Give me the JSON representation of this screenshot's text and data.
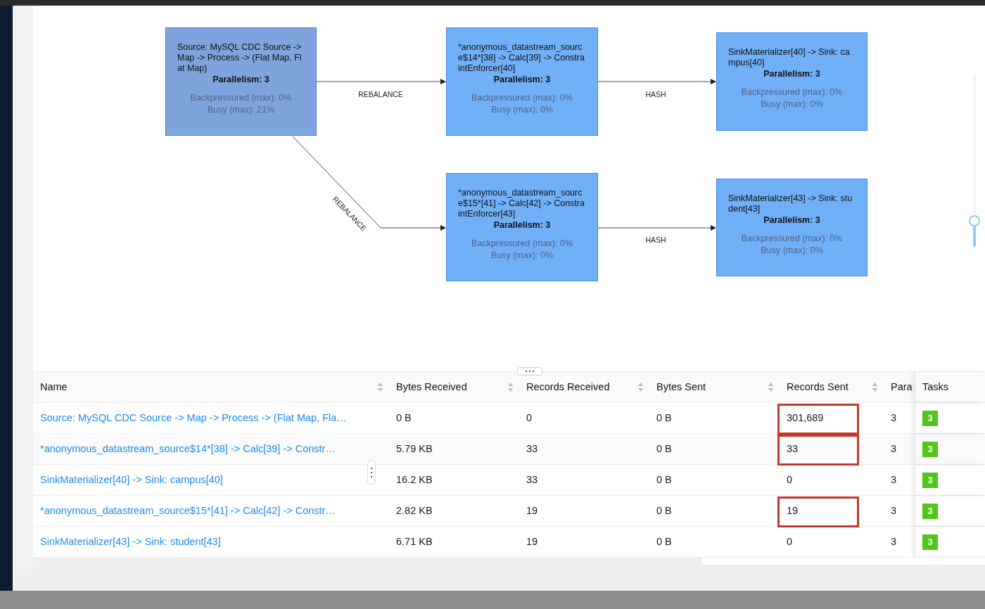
{
  "graph": {
    "nodes": [
      {
        "title": "Source: MySQL CDC Source -> Map -> Process -> (Flat Map, Flat Map)",
        "parallelism": "Parallelism: 3",
        "backpressured": "Backpressured (max): 0%",
        "busy": "Busy (max): 21%",
        "selected": true
      },
      {
        "title": "*anonymous_datastream_source$14*[38] -> Calc[39] -> ConstraintEnforcer[40]",
        "parallelism": "Parallelism: 3",
        "backpressured": "Backpressured (max): 0%",
        "busy": "Busy (max): 0%",
        "selected": false
      },
      {
        "title": "SinkMaterializer[40] -> Sink: campus[40]",
        "parallelism": "Parallelism: 3",
        "backpressured": "Backpressured (max): 0%",
        "busy": "Busy (max): 0%",
        "selected": false
      },
      {
        "title": "*anonymous_datastream_source$15*[41] -> Calc[42] -> ConstraintEnforcer[43]",
        "parallelism": "Parallelism: 3",
        "backpressured": "Backpressured (max): 0%",
        "busy": "Busy (max): 0%",
        "selected": false
      },
      {
        "title": "SinkMaterializer[43] -> Sink: student[43]",
        "parallelism": "Parallelism: 3",
        "backpressured": "Backpressured (max): 0%",
        "busy": "Busy (max): 0%",
        "selected": false
      }
    ],
    "edges": [
      {
        "label": "REBALANCE"
      },
      {
        "label": "HASH"
      },
      {
        "label": "REBALANCE"
      },
      {
        "label": "HASH"
      }
    ],
    "zoom": {
      "level": 0.15
    }
  },
  "table": {
    "columns": [
      {
        "label": "Name",
        "sortable": true
      },
      {
        "label": "Bytes Received",
        "sortable": true
      },
      {
        "label": "Records Received",
        "sortable": true
      },
      {
        "label": "Bytes Sent",
        "sortable": true
      },
      {
        "label": "Records Sent",
        "sortable": true
      },
      {
        "label": "Para",
        "sortable": false
      },
      {
        "label": "Tasks",
        "sortable": false
      }
    ],
    "rows": [
      {
        "name": "Source: MySQL CDC Source -> Map -> Process -> (Flat Map, Fla…",
        "bytes_received": "0 B",
        "records_received": "0",
        "bytes_sent": "0 B",
        "records_sent": "301,689",
        "parallelism": "3",
        "tasks": "3",
        "hovered": false,
        "annotated": true
      },
      {
        "name": "*anonymous_datastream_source$14*[38] -> Calc[39] -> Constr…",
        "bytes_received": "5.79 KB",
        "records_received": "33",
        "bytes_sent": "0 B",
        "records_sent": "33",
        "parallelism": "3",
        "tasks": "3",
        "hovered": true,
        "annotated": true
      },
      {
        "name": "SinkMaterializer[40] -> Sink: campus[40]",
        "bytes_received": "16.2 KB",
        "records_received": "33",
        "bytes_sent": "0 B",
        "records_sent": "0",
        "parallelism": "3",
        "tasks": "3",
        "hovered": false,
        "annotated": false
      },
      {
        "name": "*anonymous_datastream_source$15*[41] -> Calc[42] -> Constr…",
        "bytes_received": "2.82 KB",
        "records_received": "19",
        "bytes_sent": "0 B",
        "records_sent": "19",
        "parallelism": "3",
        "tasks": "3",
        "hovered": false,
        "annotated": true
      },
      {
        "name": "SinkMaterializer[43] -> Sink: student[43]",
        "bytes_received": "6.71 KB",
        "records_received": "19",
        "bytes_sent": "0 B",
        "records_sent": "0",
        "parallelism": "3",
        "tasks": "3",
        "hovered": false,
        "annotated": false
      }
    ]
  }
}
